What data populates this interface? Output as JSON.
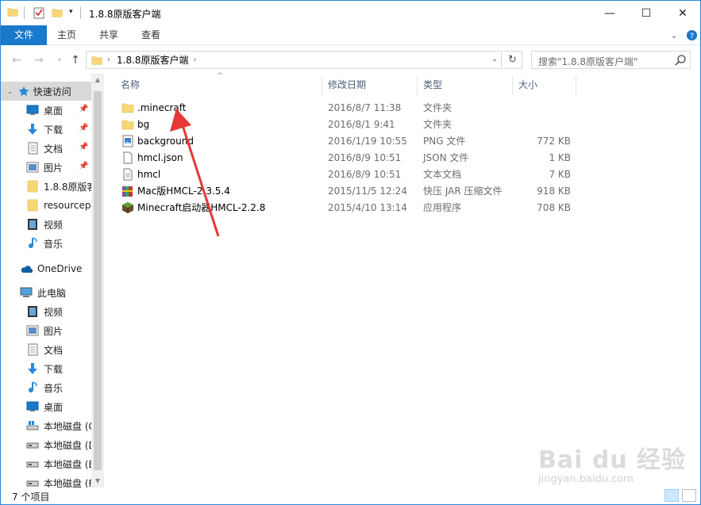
{
  "window": {
    "title": "1.8.8原版客户端",
    "controls": {
      "minimize": "—",
      "maximize": "☐",
      "close": "✕"
    }
  },
  "ribbon": {
    "tabs": [
      "文件",
      "主页",
      "共享",
      "查看"
    ]
  },
  "address": {
    "crumb": "1.8.8原版客户端",
    "search_placeholder": "搜索\"1.8.8原版客户端\""
  },
  "nav": {
    "quick_access": "快速访问",
    "items": [
      {
        "label": "桌面",
        "icon": "desktop-icon",
        "pinned": true
      },
      {
        "label": "下载",
        "icon": "download-icon",
        "pinned": true
      },
      {
        "label": "文档",
        "icon": "document-icon",
        "pinned": true
      },
      {
        "label": "图片",
        "icon": "picture-icon",
        "pinned": true
      },
      {
        "label": "1.8.8原版客",
        "icon": "folder-icon",
        "pinned": false
      },
      {
        "label": "resourcep",
        "icon": "folder-icon",
        "pinned": false
      },
      {
        "label": "视频",
        "icon": "video-icon",
        "pinned": false
      },
      {
        "label": "音乐",
        "icon": "music-icon",
        "pinned": false
      }
    ],
    "onedrive": "OneDrive",
    "this_pc": "此电脑",
    "pc_items": [
      {
        "label": "视频",
        "icon": "video-icon"
      },
      {
        "label": "图片",
        "icon": "picture-icon"
      },
      {
        "label": "文档",
        "icon": "document-icon"
      },
      {
        "label": "下载",
        "icon": "download-icon"
      },
      {
        "label": "音乐",
        "icon": "music-icon"
      },
      {
        "label": "桌面",
        "icon": "desktop-icon"
      },
      {
        "label": "本地磁盘 (C",
        "icon": "drive-c-icon"
      },
      {
        "label": "本地磁盘 (D",
        "icon": "drive-icon"
      },
      {
        "label": "本地磁盘 (E",
        "icon": "drive-icon"
      },
      {
        "label": "本地磁盘 (F",
        "icon": "drive-icon"
      }
    ]
  },
  "columns": {
    "name": "名称",
    "date": "修改日期",
    "type": "类型",
    "size": "大小"
  },
  "files": [
    {
      "name": ".minecraft",
      "date": "2016/8/7 11:38",
      "type": "文件夹",
      "size": "",
      "icon": "folder-icon"
    },
    {
      "name": "bg",
      "date": "2016/8/1 9:41",
      "type": "文件夹",
      "size": "",
      "icon": "folder-icon"
    },
    {
      "name": "background",
      "date": "2016/1/19 10:55",
      "type": "PNG 文件",
      "size": "772 KB",
      "icon": "image-file-icon"
    },
    {
      "name": "hmcl.json",
      "date": "2016/8/9 10:51",
      "type": "JSON 文件",
      "size": "1 KB",
      "icon": "json-file-icon"
    },
    {
      "name": "hmcl",
      "date": "2016/8/9 10:51",
      "type": "文本文档",
      "size": "7 KB",
      "icon": "text-file-icon"
    },
    {
      "name": "Mac版HMCL-2.3.5.4",
      "date": "2015/11/5 12:24",
      "type": "快压 JAR 压缩文件",
      "size": "918 KB",
      "icon": "archive-icon"
    },
    {
      "name": "Minecraft启动器HMCL-2.2.8",
      "date": "2015/4/10 13:14",
      "type": "应用程序",
      "size": "708 KB",
      "icon": "minecraft-app-icon"
    }
  ],
  "status": {
    "count": "7 个项目"
  },
  "watermark": {
    "logo": "Bai du 经验",
    "url": "jingyan.baidu.com"
  },
  "colors": {
    "accent": "#1979ca",
    "folder": "#f8d775",
    "arrow": "#e53935"
  }
}
